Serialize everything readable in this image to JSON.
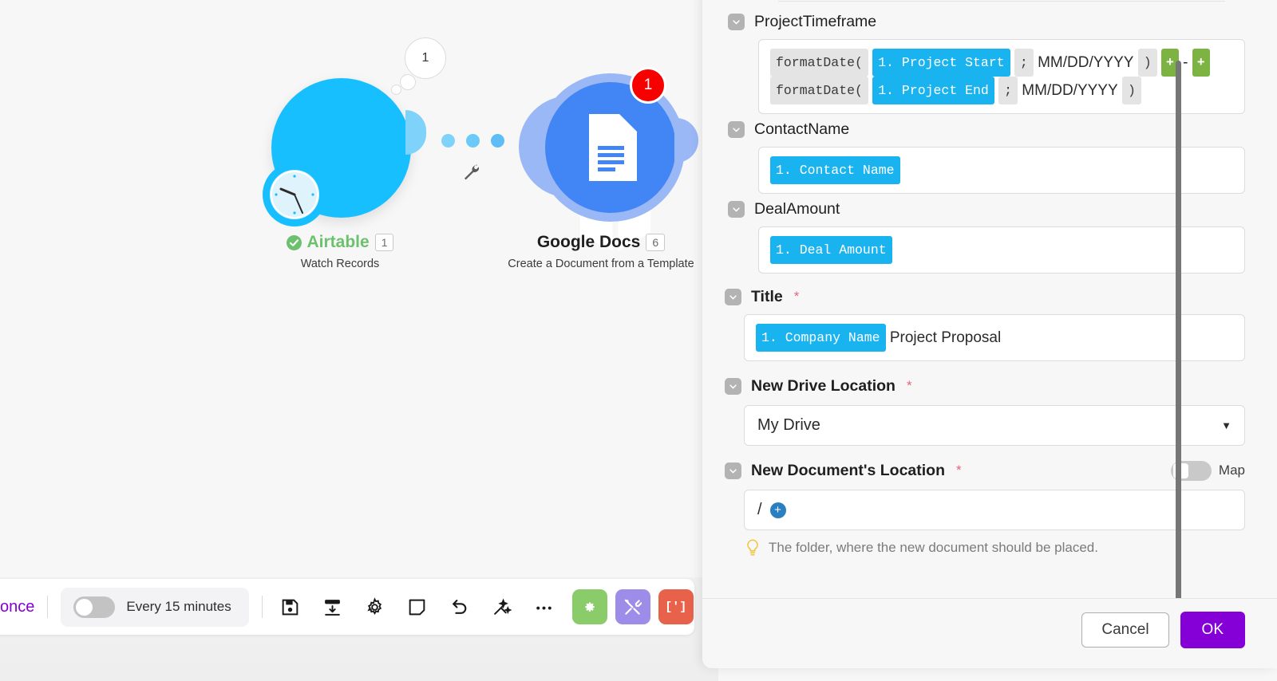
{
  "canvas": {
    "modules": [
      {
        "id": "airtable",
        "name": "Airtable",
        "sequence": "1",
        "operation": "Watch Records",
        "status_icon": "check-circle-icon",
        "bubble_count": "1",
        "color": "#18bfff"
      },
      {
        "id": "google-docs",
        "name": "Google Docs",
        "sequence": "6",
        "operation": "Create a Document from a Template",
        "error_badge": "1",
        "color": "#4285f4"
      }
    ],
    "wrench_icon": "wrench-icon"
  },
  "toolbar": {
    "run_once_label": "once",
    "schedule_toggle_state": "off",
    "schedule_label": "Every 15 minutes",
    "icons": [
      {
        "name": "save-icon",
        "label": "Save"
      },
      {
        "name": "align-icon",
        "label": "Auto-align"
      },
      {
        "name": "gear-icon",
        "label": "Settings"
      },
      {
        "name": "note-icon",
        "label": "Notes"
      },
      {
        "name": "undo-icon",
        "label": "Undo"
      },
      {
        "name": "magic-wand-icon",
        "label": "Auto-align magic"
      },
      {
        "name": "more-icon",
        "label": "More"
      }
    ],
    "color_buttons": [
      {
        "name": "explain-flow-button",
        "icon": "gear-icon",
        "color": "#8bcc6a"
      },
      {
        "name": "tools-button",
        "icon": "tools-icon",
        "color": "#9d8ce8"
      },
      {
        "name": "code-button",
        "icon": "brackets-icon",
        "label": "[']",
        "color": "#e8614b"
      }
    ]
  },
  "panel": {
    "fields": [
      {
        "label": "ProjectTimeframe",
        "bold": false,
        "required": false,
        "type": "formula",
        "tokens": [
          {
            "kind": "fn",
            "text": "formatDate("
          },
          {
            "kind": "var",
            "text": "1. Project Start"
          },
          {
            "kind": "fn",
            "text": ";"
          },
          {
            "kind": "plain",
            "text": "MM/DD/YYYY"
          },
          {
            "kind": "fn",
            "text": ")"
          },
          {
            "kind": "op",
            "text": "+"
          },
          {
            "kind": "plain",
            "text": "-"
          },
          {
            "kind": "op",
            "text": "+"
          },
          {
            "kind": "fn",
            "text": "formatDate("
          },
          {
            "kind": "var",
            "text": "1. Project End"
          },
          {
            "kind": "fn",
            "text": ";"
          },
          {
            "kind": "plain",
            "text": "MM/DD/YYYY"
          },
          {
            "kind": "fn",
            "text": ")"
          }
        ]
      },
      {
        "label": "ContactName",
        "bold": false,
        "required": false,
        "type": "tokens",
        "tokens": [
          {
            "kind": "var",
            "text": "1. Contact Name"
          }
        ]
      },
      {
        "label": "DealAmount",
        "bold": false,
        "required": false,
        "type": "tokens",
        "tokens": [
          {
            "kind": "var",
            "text": "1. Deal Amount"
          }
        ]
      },
      {
        "label": "Title",
        "bold": true,
        "required": true,
        "type": "tokens",
        "tokens": [
          {
            "kind": "var",
            "text": "1. Company Name"
          },
          {
            "kind": "plain",
            "text": "Project Proposal"
          }
        ]
      },
      {
        "label": "New Drive Location",
        "bold": true,
        "required": true,
        "type": "select",
        "value": "My Drive"
      },
      {
        "label": "New Document's Location",
        "bold": true,
        "required": true,
        "type": "path",
        "value": "/",
        "map_toggle": {
          "label": "Map",
          "state": "off"
        },
        "hint": "The folder, where the new document should be placed."
      }
    ],
    "footer": {
      "cancel_label": "Cancel",
      "ok_label": "OK"
    }
  },
  "colors": {
    "accent_purple": "#8400d6",
    "token_blue": "#19b3f0",
    "token_green": "#7cb342",
    "error_red": "#f70000",
    "airtable_blue": "#18bfff",
    "gdocs_blue": "#4285f4",
    "status_green": "#6dc06d"
  }
}
